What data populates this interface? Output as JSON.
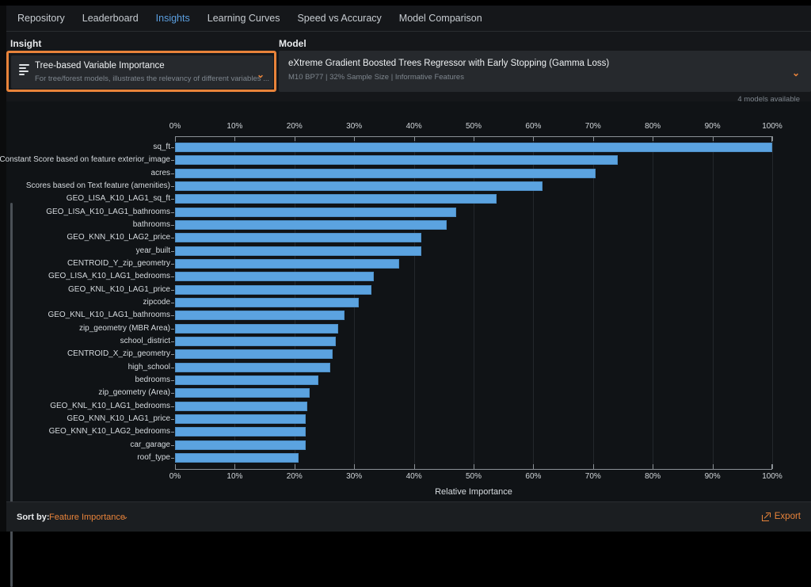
{
  "tabs": [
    {
      "label": "Repository",
      "active": false
    },
    {
      "label": "Leaderboard",
      "active": false
    },
    {
      "label": "Insights",
      "active": true
    },
    {
      "label": "Learning Curves",
      "active": false
    },
    {
      "label": "Speed vs Accuracy",
      "active": false
    },
    {
      "label": "Model Comparison",
      "active": false
    }
  ],
  "insight": {
    "column_label": "Insight",
    "title": "Tree-based Variable Importance",
    "subtitle": "For tree/forest models, illustrates the relevancy of different variables ...",
    "chevron": "⌄",
    "icon": "list-bars-icon"
  },
  "model": {
    "column_label": "Model",
    "title": "eXtreme Gradient Boosted Trees Regressor with Early Stopping (Gamma Loss)",
    "subtitle": "M10 BP77 | 32% Sample Size | Informative Features",
    "chevron": "⌄",
    "available": "4 models available"
  },
  "footer": {
    "sort_by_label": "Sort by:",
    "sort_by_value": "Feature Importance",
    "sort_chevron": "⌄",
    "export_label": "Export",
    "export_icon": "export-external-link-icon"
  },
  "colors": {
    "accent": "#e8833a",
    "bar": "#5ba3e0",
    "active_tab": "#5b9fe0",
    "panel": "#15171a",
    "chart_bg": "#101316"
  },
  "chart_data": {
    "type": "bar",
    "orientation": "horizontal",
    "title": "",
    "xlabel": "Relative Importance",
    "ylabel": "",
    "xlim": [
      0,
      100
    ],
    "xticks": [
      "0%",
      "10%",
      "20%",
      "30%",
      "40%",
      "50%",
      "60%",
      "70%",
      "80%",
      "90%",
      "100%"
    ],
    "xtick_values": [
      0,
      10,
      20,
      30,
      40,
      50,
      60,
      70,
      80,
      90,
      100
    ],
    "grid": true,
    "legend": "none",
    "dual_axis": "top and bottom",
    "categories": [
      "sq_ft",
      "Constant Score based on feature exterior_image",
      "acres",
      "Scores based on Text feature (amenities)",
      "GEO_LISA_K10_LAG1_sq_ft",
      "GEO_LISA_K10_LAG1_bathrooms",
      "bathrooms",
      "GEO_KNN_K10_LAG2_price",
      "year_built",
      "CENTROID_Y_zip_geometry",
      "GEO_LISA_K10_LAG1_bedrooms",
      "GEO_KNL_K10_LAG1_price",
      "zipcode",
      "GEO_KNL_K10_LAG1_bathrooms",
      "zip_geometry (MBR Area)",
      "school_district",
      "CENTROID_X_zip_geometry",
      "high_school",
      "bedrooms",
      "zip_geometry (Area)",
      "GEO_KNL_K10_LAG1_bedrooms",
      "GEO_KNN_K10_LAG1_price",
      "GEO_KNN_K10_LAG2_bedrooms",
      "car_garage",
      "roof_type"
    ],
    "values": [
      100.0,
      74.1,
      70.4,
      61.6,
      53.8,
      47.1,
      45.5,
      41.2,
      41.2,
      37.5,
      33.3,
      32.9,
      30.8,
      28.4,
      27.3,
      26.9,
      26.4,
      26.0,
      24.0,
      22.5,
      22.1,
      21.9,
      21.9,
      21.9,
      20.7
    ]
  }
}
